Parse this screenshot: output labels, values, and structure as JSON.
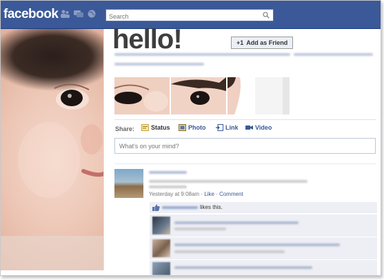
{
  "topbar": {
    "logo": "facebook",
    "search": {
      "placeholder": "Search",
      "value": ""
    }
  },
  "profile": {
    "name": "hello!",
    "add_friend_label": "Add as Friend",
    "add_friend_prefix": "+1"
  },
  "share": {
    "label": "Share:",
    "items": [
      {
        "label": "Status",
        "icon": "status-icon"
      },
      {
        "label": "Photo",
        "icon": "photo-icon"
      },
      {
        "label": "Link",
        "icon": "link-icon"
      },
      {
        "label": "Video",
        "icon": "video-icon"
      }
    ],
    "status_placeholder": "What's on your mind?"
  },
  "feed": {
    "post": {
      "time": "Yesterday at 9:08am",
      "sep1": "·",
      "like_label": "Like",
      "sep2": "·",
      "comment_label": "Comment"
    },
    "likes_text": "likes this."
  },
  "colors": {
    "brand": "#3b5998",
    "link": "#3b5998",
    "feedback_bg": "#edeff4"
  }
}
